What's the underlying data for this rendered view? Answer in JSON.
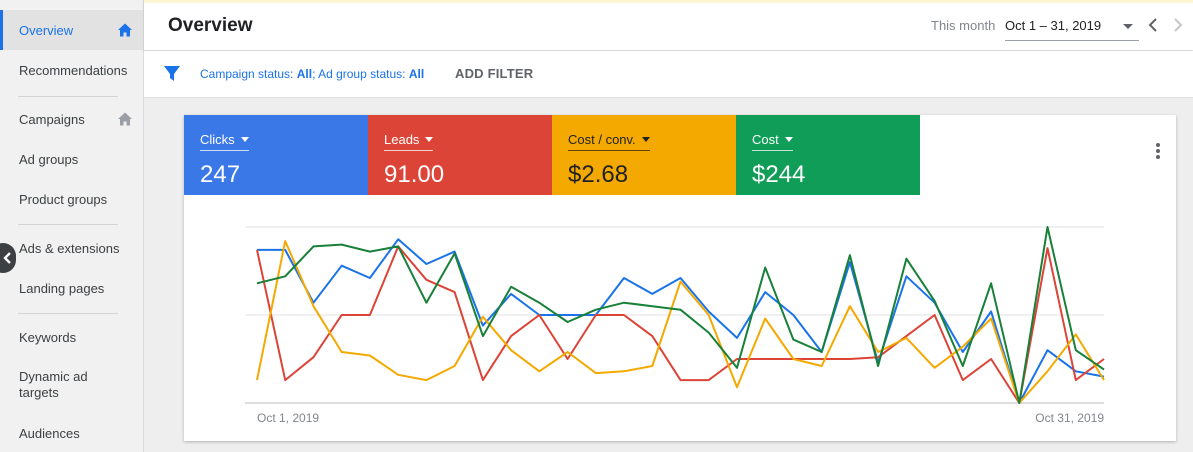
{
  "sidebar": {
    "items": [
      {
        "label": "Overview"
      },
      {
        "label": "Recommendations"
      },
      {
        "label": "Campaigns"
      },
      {
        "label": "Ad groups"
      },
      {
        "label": "Product groups"
      },
      {
        "label": "Ads & extensions"
      },
      {
        "label": "Landing pages"
      },
      {
        "label": "Keywords"
      },
      {
        "label": "Dynamic ad targets"
      },
      {
        "label": "Audiences"
      }
    ],
    "active_item": "Overview"
  },
  "header": {
    "title": "Overview",
    "date_range_label": "This month",
    "date_range_value": "Oct 1 – 31, 2019"
  },
  "filter": {
    "campaign_status_prefix": "Campaign status: ",
    "campaign_status_value": "All",
    "separator": "; ",
    "ad_group_status_prefix": "Ad group status: ",
    "ad_group_status_value": "All",
    "add_filter_label": "ADD FILTER"
  },
  "metrics": [
    {
      "label": "Clicks",
      "value": "247",
      "color": "#3b78e7"
    },
    {
      "label": "Leads",
      "value": "91.00",
      "color": "#db4437"
    },
    {
      "label": "Cost / conv.",
      "value": "$2.68",
      "color": "#f4a900"
    },
    {
      "label": "Cost",
      "value": "$244",
      "color": "#0f9d58"
    }
  ],
  "chart_data": {
    "type": "line",
    "x_start_label": "Oct 1, 2019",
    "x_end_label": "Oct 31, 2019",
    "x": [
      1,
      2,
      3,
      4,
      5,
      6,
      7,
      8,
      9,
      10,
      11,
      12,
      13,
      14,
      15,
      16,
      17,
      18,
      19,
      20,
      21,
      22,
      23,
      24,
      25,
      26,
      27,
      28,
      29,
      30,
      31
    ],
    "ylim": [
      0,
      100
    ],
    "grid": true,
    "series": [
      {
        "name": "Clicks",
        "color": "#1a73e8",
        "values": [
          87,
          87,
          57,
          78,
          71,
          93,
          79,
          86,
          44,
          62,
          50,
          50,
          50,
          71,
          62,
          71,
          52,
          37,
          63,
          50,
          29,
          80,
          23,
          72,
          57,
          29,
          52,
          0,
          30,
          18,
          15
        ]
      },
      {
        "name": "Leads",
        "color": "#db4437",
        "values": [
          87,
          13,
          26,
          50,
          50,
          89,
          70,
          63,
          13,
          38,
          50,
          25,
          50,
          50,
          38,
          13,
          13,
          25,
          25,
          25,
          25,
          25,
          26,
          38,
          50,
          13,
          25,
          0,
          88,
          13,
          25
        ]
      },
      {
        "name": "Cost / conv.",
        "color": "#f4a900",
        "values": [
          13,
          92,
          55,
          29,
          27,
          16,
          13,
          21,
          49,
          30,
          18,
          29,
          17,
          18,
          21,
          69,
          50,
          9,
          48,
          25,
          21,
          55,
          29,
          37,
          20,
          32,
          48,
          0,
          18,
          39,
          13
        ]
      },
      {
        "name": "Cost",
        "color": "#188038",
        "values": [
          68,
          72,
          89,
          90,
          86,
          89,
          57,
          85,
          38,
          66,
          57,
          46,
          53,
          57,
          55,
          53,
          40,
          20,
          77,
          36,
          29,
          84,
          21,
          82,
          58,
          21,
          68,
          0,
          100,
          30,
          19
        ]
      }
    ]
  }
}
